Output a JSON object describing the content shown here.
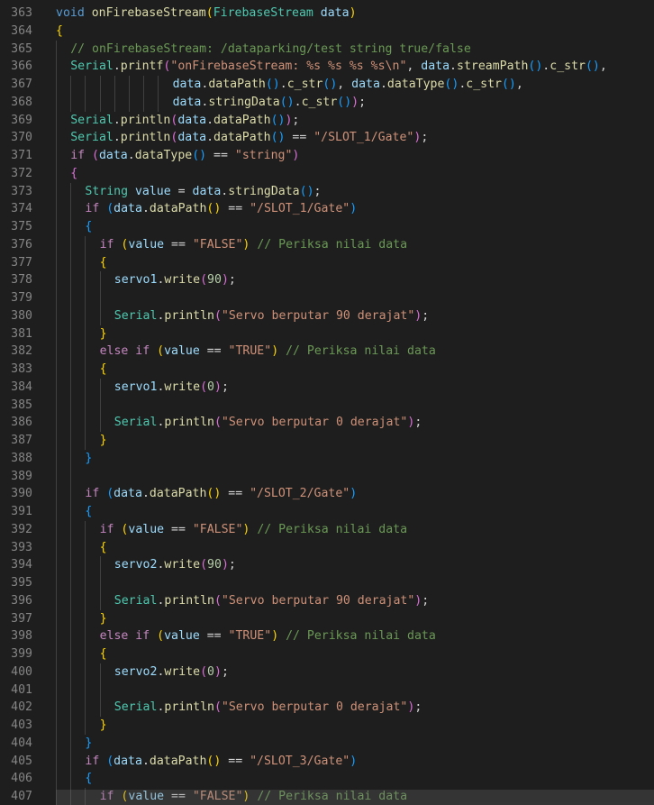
{
  "editor": {
    "language": "cpp",
    "colors": {
      "background": "#1e1e1e",
      "line_number": "#858585",
      "keyword": "#569cd6",
      "type": "#4ec9b0",
      "function": "#dcdcaa",
      "variable": "#9cdcfe",
      "string": "#ce9178",
      "number": "#b5cea8",
      "comment": "#6a9955",
      "control": "#c586c0",
      "bracket_1": "#ffd700",
      "bracket_2": "#da70d6",
      "bracket_3": "#179fff"
    },
    "lines": [
      {
        "n": "363",
        "indent": 0,
        "t": [
          [
            "k",
            "void "
          ],
          [
            "f",
            "onFirebaseStream"
          ],
          [
            "b1",
            "("
          ],
          [
            "t",
            "FirebaseStream "
          ],
          [
            "v",
            "data"
          ],
          [
            "b1",
            ")"
          ]
        ]
      },
      {
        "n": "364",
        "indent": 0,
        "t": [
          [
            "b1",
            "{"
          ]
        ]
      },
      {
        "n": "365",
        "indent": 1,
        "t": [
          [
            "c",
            "// onFirebaseStream: /dataparking/test string true/false"
          ]
        ]
      },
      {
        "n": "366",
        "indent": 1,
        "t": [
          [
            "t",
            "Serial"
          ],
          [
            "p",
            "."
          ],
          [
            "f",
            "printf"
          ],
          [
            "b2",
            "("
          ],
          [
            "s",
            "\"onFirebaseStream: %s %s %s %s\\n\""
          ],
          [
            "p",
            ", "
          ],
          [
            "v",
            "data"
          ],
          [
            "p",
            "."
          ],
          [
            "f",
            "streamPath"
          ],
          [
            "b3",
            "()"
          ],
          [
            "p",
            "."
          ],
          [
            "f",
            "c_str"
          ],
          [
            "b3",
            "()"
          ],
          [
            "p",
            ","
          ]
        ]
      },
      {
        "n": "367",
        "indent": 8,
        "t": [
          [
            "v",
            "data"
          ],
          [
            "p",
            "."
          ],
          [
            "f",
            "dataPath"
          ],
          [
            "b3",
            "()"
          ],
          [
            "p",
            "."
          ],
          [
            "f",
            "c_str"
          ],
          [
            "b3",
            "()"
          ],
          [
            "p",
            ", "
          ],
          [
            "v",
            "data"
          ],
          [
            "p",
            "."
          ],
          [
            "f",
            "dataType"
          ],
          [
            "b3",
            "()"
          ],
          [
            "p",
            "."
          ],
          [
            "f",
            "c_str"
          ],
          [
            "b3",
            "()"
          ],
          [
            "p",
            ","
          ]
        ]
      },
      {
        "n": "368",
        "indent": 8,
        "t": [
          [
            "v",
            "data"
          ],
          [
            "p",
            "."
          ],
          [
            "f",
            "stringData"
          ],
          [
            "b3",
            "()"
          ],
          [
            "p",
            "."
          ],
          [
            "f",
            "c_str"
          ],
          [
            "b3",
            "()"
          ],
          [
            "b2",
            ")"
          ],
          [
            "p",
            ";"
          ]
        ]
      },
      {
        "n": "369",
        "indent": 1,
        "t": [
          [
            "t",
            "Serial"
          ],
          [
            "p",
            "."
          ],
          [
            "f",
            "println"
          ],
          [
            "b2",
            "("
          ],
          [
            "v",
            "data"
          ],
          [
            "p",
            "."
          ],
          [
            "f",
            "dataPath"
          ],
          [
            "b3",
            "()"
          ],
          [
            "b2",
            ")"
          ],
          [
            "p",
            ";"
          ]
        ]
      },
      {
        "n": "370",
        "indent": 1,
        "t": [
          [
            "t",
            "Serial"
          ],
          [
            "p",
            "."
          ],
          [
            "f",
            "println"
          ],
          [
            "b2",
            "("
          ],
          [
            "v",
            "data"
          ],
          [
            "p",
            "."
          ],
          [
            "f",
            "dataPath"
          ],
          [
            "b3",
            "()"
          ],
          [
            "p",
            " == "
          ],
          [
            "s",
            "\"/SLOT_1/Gate\""
          ],
          [
            "b2",
            ")"
          ],
          [
            "p",
            ";"
          ]
        ]
      },
      {
        "n": "371",
        "indent": 1,
        "t": [
          [
            "ctl",
            "if "
          ],
          [
            "b2",
            "("
          ],
          [
            "v",
            "data"
          ],
          [
            "p",
            "."
          ],
          [
            "f",
            "dataType"
          ],
          [
            "b3",
            "()"
          ],
          [
            "p",
            " == "
          ],
          [
            "s",
            "\"string\""
          ],
          [
            "b2",
            ")"
          ]
        ]
      },
      {
        "n": "372",
        "indent": 1,
        "t": [
          [
            "b2",
            "{"
          ]
        ]
      },
      {
        "n": "373",
        "indent": 2,
        "t": [
          [
            "t",
            "String "
          ],
          [
            "v",
            "value"
          ],
          [
            "p",
            " = "
          ],
          [
            "v",
            "data"
          ],
          [
            "p",
            "."
          ],
          [
            "f",
            "stringData"
          ],
          [
            "b3",
            "()"
          ],
          [
            "p",
            ";"
          ]
        ]
      },
      {
        "n": "374",
        "indent": 2,
        "t": [
          [
            "ctl",
            "if "
          ],
          [
            "b3",
            "("
          ],
          [
            "v",
            "data"
          ],
          [
            "p",
            "."
          ],
          [
            "f",
            "dataPath"
          ],
          [
            "b1",
            "()"
          ],
          [
            "p",
            " == "
          ],
          [
            "s",
            "\"/SLOT_1/Gate\""
          ],
          [
            "b3",
            ")"
          ]
        ]
      },
      {
        "n": "375",
        "indent": 2,
        "t": [
          [
            "b3",
            "{"
          ]
        ]
      },
      {
        "n": "376",
        "indent": 3,
        "t": [
          [
            "ctl",
            "if "
          ],
          [
            "b1",
            "("
          ],
          [
            "v",
            "value"
          ],
          [
            "p",
            " == "
          ],
          [
            "s",
            "\"FALSE\""
          ],
          [
            "b1",
            ")"
          ],
          [
            "c",
            " // Periksa nilai data"
          ]
        ]
      },
      {
        "n": "377",
        "indent": 3,
        "t": [
          [
            "b1",
            "{"
          ]
        ]
      },
      {
        "n": "378",
        "indent": 4,
        "t": [
          [
            "v",
            "servo1"
          ],
          [
            "p",
            "."
          ],
          [
            "f",
            "write"
          ],
          [
            "b2",
            "("
          ],
          [
            "n",
            "90"
          ],
          [
            "b2",
            ")"
          ],
          [
            "p",
            ";"
          ]
        ]
      },
      {
        "n": "379",
        "indent": 4,
        "t": []
      },
      {
        "n": "380",
        "indent": 4,
        "t": [
          [
            "t",
            "Serial"
          ],
          [
            "p",
            "."
          ],
          [
            "f",
            "println"
          ],
          [
            "b2",
            "("
          ],
          [
            "s",
            "\"Servo berputar 90 derajat\""
          ],
          [
            "b2",
            ")"
          ],
          [
            "p",
            ";"
          ]
        ]
      },
      {
        "n": "381",
        "indent": 3,
        "t": [
          [
            "b1",
            "}"
          ]
        ]
      },
      {
        "n": "382",
        "indent": 3,
        "t": [
          [
            "ctl",
            "else if "
          ],
          [
            "b1",
            "("
          ],
          [
            "v",
            "value"
          ],
          [
            "p",
            " == "
          ],
          [
            "s",
            "\"TRUE\""
          ],
          [
            "b1",
            ")"
          ],
          [
            "c",
            " // Periksa nilai data"
          ]
        ]
      },
      {
        "n": "383",
        "indent": 3,
        "t": [
          [
            "b1",
            "{"
          ]
        ]
      },
      {
        "n": "384",
        "indent": 4,
        "t": [
          [
            "v",
            "servo1"
          ],
          [
            "p",
            "."
          ],
          [
            "f",
            "write"
          ],
          [
            "b2",
            "("
          ],
          [
            "n",
            "0"
          ],
          [
            "b2",
            ")"
          ],
          [
            "p",
            ";"
          ]
        ]
      },
      {
        "n": "385",
        "indent": 4,
        "t": []
      },
      {
        "n": "386",
        "indent": 4,
        "t": [
          [
            "t",
            "Serial"
          ],
          [
            "p",
            "."
          ],
          [
            "f",
            "println"
          ],
          [
            "b2",
            "("
          ],
          [
            "s",
            "\"Servo berputar 0 derajat\""
          ],
          [
            "b2",
            ")"
          ],
          [
            "p",
            ";"
          ]
        ]
      },
      {
        "n": "387",
        "indent": 3,
        "t": [
          [
            "b1",
            "}"
          ]
        ]
      },
      {
        "n": "388",
        "indent": 2,
        "t": [
          [
            "b3",
            "}"
          ]
        ]
      },
      {
        "n": "389",
        "indent": 2,
        "t": []
      },
      {
        "n": "390",
        "indent": 2,
        "t": [
          [
            "ctl",
            "if "
          ],
          [
            "b3",
            "("
          ],
          [
            "v",
            "data"
          ],
          [
            "p",
            "."
          ],
          [
            "f",
            "dataPath"
          ],
          [
            "b1",
            "()"
          ],
          [
            "p",
            " == "
          ],
          [
            "s",
            "\"/SLOT_2/Gate\""
          ],
          [
            "b3",
            ")"
          ]
        ]
      },
      {
        "n": "391",
        "indent": 2,
        "t": [
          [
            "b3",
            "{"
          ]
        ]
      },
      {
        "n": "392",
        "indent": 3,
        "t": [
          [
            "ctl",
            "if "
          ],
          [
            "b1",
            "("
          ],
          [
            "v",
            "value"
          ],
          [
            "p",
            " == "
          ],
          [
            "s",
            "\"FALSE\""
          ],
          [
            "b1",
            ")"
          ],
          [
            "c",
            " // Periksa nilai data"
          ]
        ]
      },
      {
        "n": "393",
        "indent": 3,
        "t": [
          [
            "b1",
            "{"
          ]
        ]
      },
      {
        "n": "394",
        "indent": 4,
        "t": [
          [
            "v",
            "servo2"
          ],
          [
            "p",
            "."
          ],
          [
            "f",
            "write"
          ],
          [
            "b2",
            "("
          ],
          [
            "n",
            "90"
          ],
          [
            "b2",
            ")"
          ],
          [
            "p",
            ";"
          ]
        ]
      },
      {
        "n": "395",
        "indent": 4,
        "t": []
      },
      {
        "n": "396",
        "indent": 4,
        "t": [
          [
            "t",
            "Serial"
          ],
          [
            "p",
            "."
          ],
          [
            "f",
            "println"
          ],
          [
            "b2",
            "("
          ],
          [
            "s",
            "\"Servo berputar 90 derajat\""
          ],
          [
            "b2",
            ")"
          ],
          [
            "p",
            ";"
          ]
        ]
      },
      {
        "n": "397",
        "indent": 3,
        "t": [
          [
            "b1",
            "}"
          ]
        ]
      },
      {
        "n": "398",
        "indent": 3,
        "t": [
          [
            "ctl",
            "else if "
          ],
          [
            "b1",
            "("
          ],
          [
            "v",
            "value"
          ],
          [
            "p",
            " == "
          ],
          [
            "s",
            "\"TRUE\""
          ],
          [
            "b1",
            ")"
          ],
          [
            "c",
            " // Periksa nilai data"
          ]
        ]
      },
      {
        "n": "399",
        "indent": 3,
        "t": [
          [
            "b1",
            "{"
          ]
        ]
      },
      {
        "n": "400",
        "indent": 4,
        "t": [
          [
            "v",
            "servo2"
          ],
          [
            "p",
            "."
          ],
          [
            "f",
            "write"
          ],
          [
            "b2",
            "("
          ],
          [
            "n",
            "0"
          ],
          [
            "b2",
            ")"
          ],
          [
            "p",
            ";"
          ]
        ]
      },
      {
        "n": "401",
        "indent": 4,
        "t": []
      },
      {
        "n": "402",
        "indent": 4,
        "t": [
          [
            "t",
            "Serial"
          ],
          [
            "p",
            "."
          ],
          [
            "f",
            "println"
          ],
          [
            "b2",
            "("
          ],
          [
            "s",
            "\"Servo berputar 0 derajat\""
          ],
          [
            "b2",
            ")"
          ],
          [
            "p",
            ";"
          ]
        ]
      },
      {
        "n": "403",
        "indent": 3,
        "t": [
          [
            "b1",
            "}"
          ]
        ]
      },
      {
        "n": "404",
        "indent": 2,
        "t": [
          [
            "b3",
            "}"
          ]
        ]
      },
      {
        "n": "405",
        "indent": 2,
        "t": [
          [
            "ctl",
            "if "
          ],
          [
            "b3",
            "("
          ],
          [
            "v",
            "data"
          ],
          [
            "p",
            "."
          ],
          [
            "f",
            "dataPath"
          ],
          [
            "b1",
            "()"
          ],
          [
            "p",
            " == "
          ],
          [
            "s",
            "\"/SLOT_3/Gate\""
          ],
          [
            "b3",
            ")"
          ]
        ]
      },
      {
        "n": "406",
        "indent": 2,
        "t": [
          [
            "b3",
            "{"
          ]
        ]
      },
      {
        "n": "407",
        "indent": 3,
        "t": [
          [
            "ctl",
            "if "
          ],
          [
            "b1",
            "("
          ],
          [
            "v",
            "value"
          ],
          [
            "p",
            " == "
          ],
          [
            "s",
            "\"FALSE\""
          ],
          [
            "b1",
            ")"
          ],
          [
            "c",
            " // Periksa nilai data"
          ]
        ]
      }
    ]
  }
}
